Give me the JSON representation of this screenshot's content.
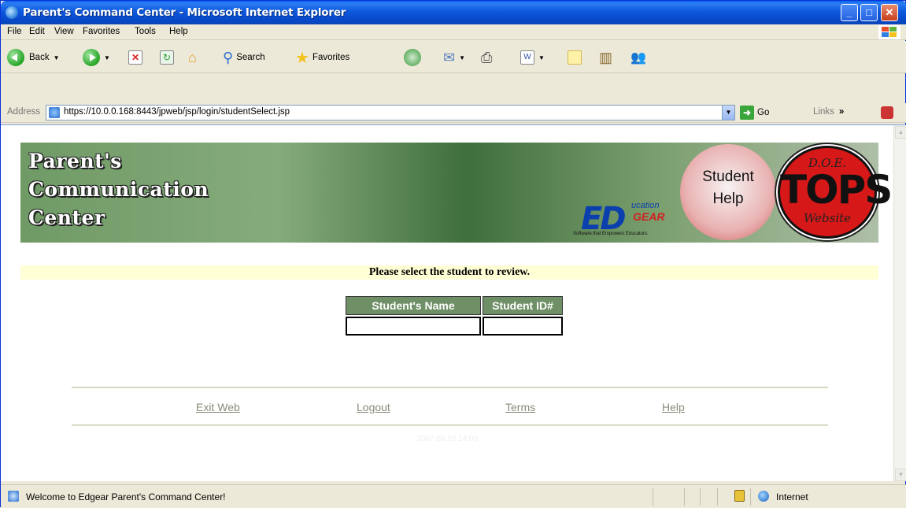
{
  "window": {
    "title": "Parent's Command Center - Microsoft Internet Explorer",
    "controls": [
      "_",
      "□",
      "✕"
    ]
  },
  "menu": {
    "items": [
      "File",
      "Edit",
      "View",
      "Favorites",
      "Tools",
      "Help"
    ]
  },
  "toolbar": {
    "back_label": "Back",
    "search_label": "Search",
    "favorites_label": "Favorites"
  },
  "address": {
    "label": "Address",
    "url": "https://10.0.0.168:8443/jpweb/jsp/login/studentSelect.jsp",
    "go_label": "Go",
    "links_label": "Links",
    "links_chevron": "»"
  },
  "banner": {
    "title_lines": [
      "Parent's",
      "Communication",
      "Center"
    ],
    "edgear_ed": "ED",
    "edgear_ucation": "ucation",
    "edgear_gear": "GEAR",
    "edgear_tagline": "Software that Empowers Educators.",
    "student_help_lines": [
      "Student",
      "Help"
    ],
    "tops_top": "D.O.E.",
    "tops_main": "TOPS",
    "tops_bottom": "Website"
  },
  "page": {
    "prompt": "Please select the student to review.",
    "table_headers": [
      "Student's Name",
      "Student ID#"
    ],
    "footer_links": [
      "Exit Web",
      "Logout",
      "Terms",
      "Help"
    ],
    "datestamp": "2007.09.10 14:00"
  },
  "status": {
    "text": "Welcome to Edgear Parent's Command Center!",
    "zone": "Internet"
  },
  "colors": {
    "title_bar": "#0d58dd",
    "banner_green": "#6f9a66",
    "prompt_bg": "#ffffd6",
    "table_header": "#6f8f66",
    "link": "#8a8a7a"
  }
}
